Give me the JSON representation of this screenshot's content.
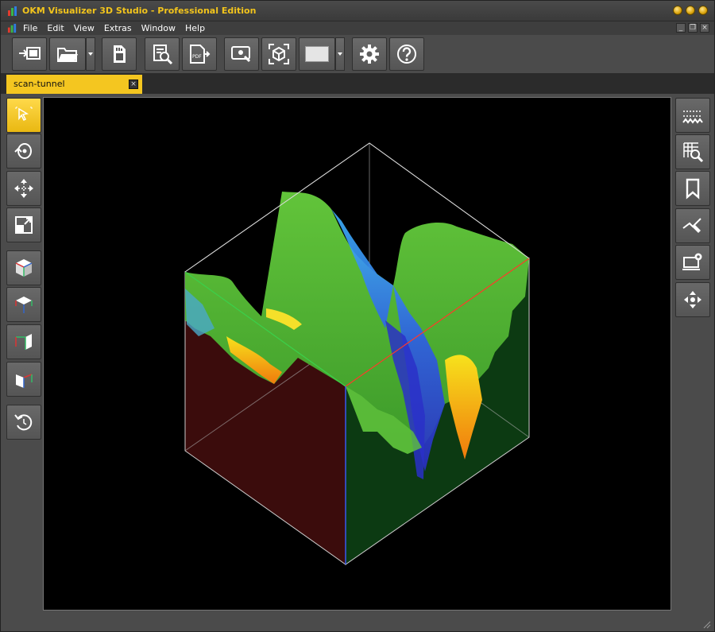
{
  "window": {
    "title": "OKM Visualizer 3D Studio - Professional Edition",
    "accent": "#f4c620"
  },
  "menu": {
    "items": [
      "File",
      "Edit",
      "View",
      "Extras",
      "Window",
      "Help"
    ]
  },
  "toolbar": {
    "buttons": [
      "import-icon",
      "open-folder-icon",
      "sd-card-icon",
      "report-search-icon",
      "pdf-export-icon",
      "screen-capture-icon",
      "3d-object-icon",
      "color-swatch-icon",
      "gear-icon",
      "help-icon"
    ]
  },
  "tabs": [
    {
      "label": "scan-tunnel",
      "close": "×"
    }
  ],
  "left_tools": [
    "select-cursor-icon",
    "rotate-icon",
    "move-icon",
    "scale-icon",
    "view-iso-icon",
    "view-top-icon",
    "view-side-icon",
    "view-front-icon",
    "reset-view-icon"
  ],
  "right_tools": [
    "height-profile-icon",
    "grid-zoom-icon",
    "bookmark-icon",
    "measure-pen-icon",
    "device-settings-icon",
    "navigate-icon"
  ],
  "mdi": {
    "minimize": "_",
    "restore": "❐",
    "close": "×"
  }
}
